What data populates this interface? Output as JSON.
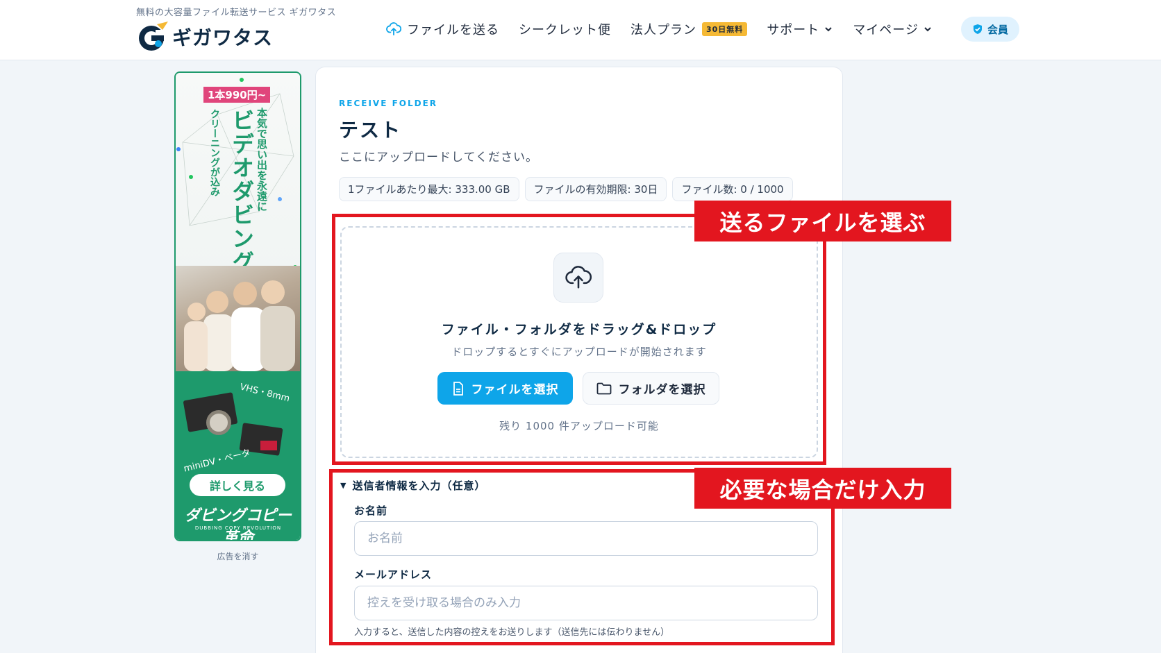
{
  "header": {
    "tagline": "無料の大容量ファイル転送サービス ギガワタス",
    "logo_text": "ギガワタス",
    "nav": [
      {
        "label": "ファイルを送る",
        "icon": "cloud-upload-icon"
      },
      {
        "label": "シークレット便"
      },
      {
        "label": "法人プラン",
        "badge": "30日無料"
      },
      {
        "label": "サポート",
        "icon": "chevron-down-icon"
      },
      {
        "label": "マイページ",
        "icon": "chevron-down-icon"
      }
    ],
    "member_label": "会員"
  },
  "ad": {
    "price": "1本990円~",
    "line1": "本気で思い出を永遠に",
    "line2": "ビデオダビング",
    "line3": "クリーニングが込み",
    "vhs": "VHS・8mm",
    "mini": "miniDV・ベータ",
    "cta": "詳しく見る",
    "brand": "ダビングコピー革命",
    "brand_sub": "DUBBING COPY REVOLUTION",
    "remove": "広告を消す"
  },
  "main": {
    "eyebrow": "RECEIVE FOLDER",
    "title": "テスト",
    "subtitle": "ここにアップロードしてください。",
    "chips": [
      "1ファイルあたり最大: 333.00 GB",
      "ファイルの有効期限: 30日",
      "ファイル数: 0 / 1000"
    ],
    "dropzone": {
      "title": "ファイル・フォルダをドラッグ&ドロップ",
      "sub": "ドロップするとすぐにアップロードが開始されます",
      "select_file": "ファイルを選択",
      "select_folder": "フォルダを選択",
      "remaining": "残り 1000 件アップロード可能"
    },
    "sender": {
      "toggle": "送信者情報を入力（任意）",
      "name_label": "お名前",
      "name_placeholder": "お名前",
      "email_label": "メールアドレス",
      "email_placeholder": "控えを受け取る場合のみ入力",
      "hint": "入力すると、送信した内容の控えをお送りします（送信先には伝わりません）"
    }
  },
  "annotations": {
    "label1": "送るファイルを選ぶ",
    "label2": "必要な場合だけ入力",
    "color": "#e3161f"
  },
  "colors": {
    "accent": "#0ea5e9",
    "navy": "#0f2a44",
    "ad_green": "#1e9a6c"
  }
}
